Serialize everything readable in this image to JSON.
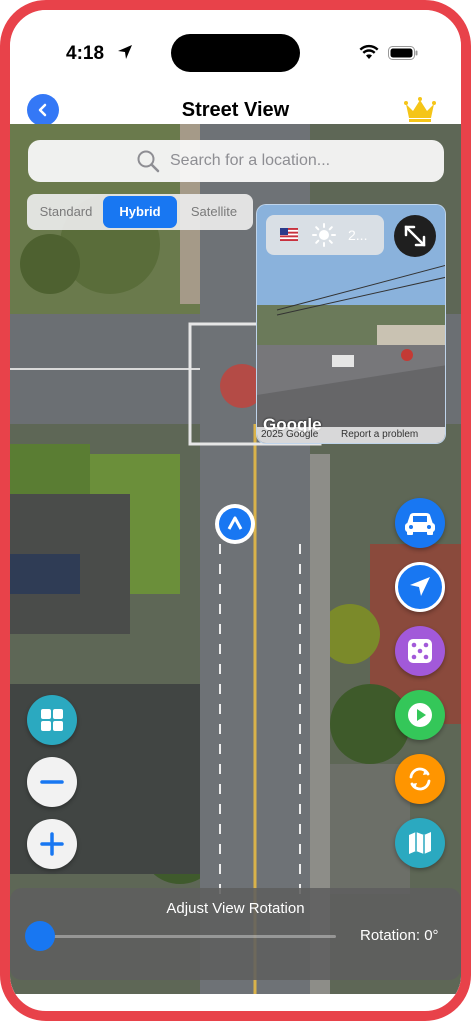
{
  "status_bar": {
    "time": "4:18"
  },
  "nav": {
    "title": "Street View"
  },
  "search": {
    "placeholder": "Search for a location..."
  },
  "map_types": [
    {
      "label": "Standard",
      "active": false
    },
    {
      "label": "Hybrid",
      "active": true
    },
    {
      "label": "Satellite",
      "active": false
    }
  ],
  "street_view": {
    "weather_text": "2...",
    "google_logo": "Google",
    "copyright": "2025 Google",
    "report": "Report a problem"
  },
  "rotation": {
    "label": "Adjust View Rotation",
    "value_text": "Rotation: 0°",
    "value_degrees": 0
  },
  "colors": {
    "frame": "#e8424a",
    "accent_blue": "#1877f2",
    "purple": "#a259d9",
    "green": "#34c759",
    "orange": "#ff9500",
    "teal": "#2ba9c0"
  },
  "icons": {
    "back": "chevron-left-icon",
    "crown": "crown-icon",
    "search": "magnifier-icon",
    "expand": "expand-arrows-icon",
    "car": "car-icon",
    "locate": "location-arrow-icon",
    "dice": "dice-icon",
    "play": "play-icon",
    "refresh": "refresh-icon",
    "map": "map-icon",
    "grid": "grid-icon",
    "zoom_out": "minus-icon",
    "zoom_in": "plus-icon"
  }
}
